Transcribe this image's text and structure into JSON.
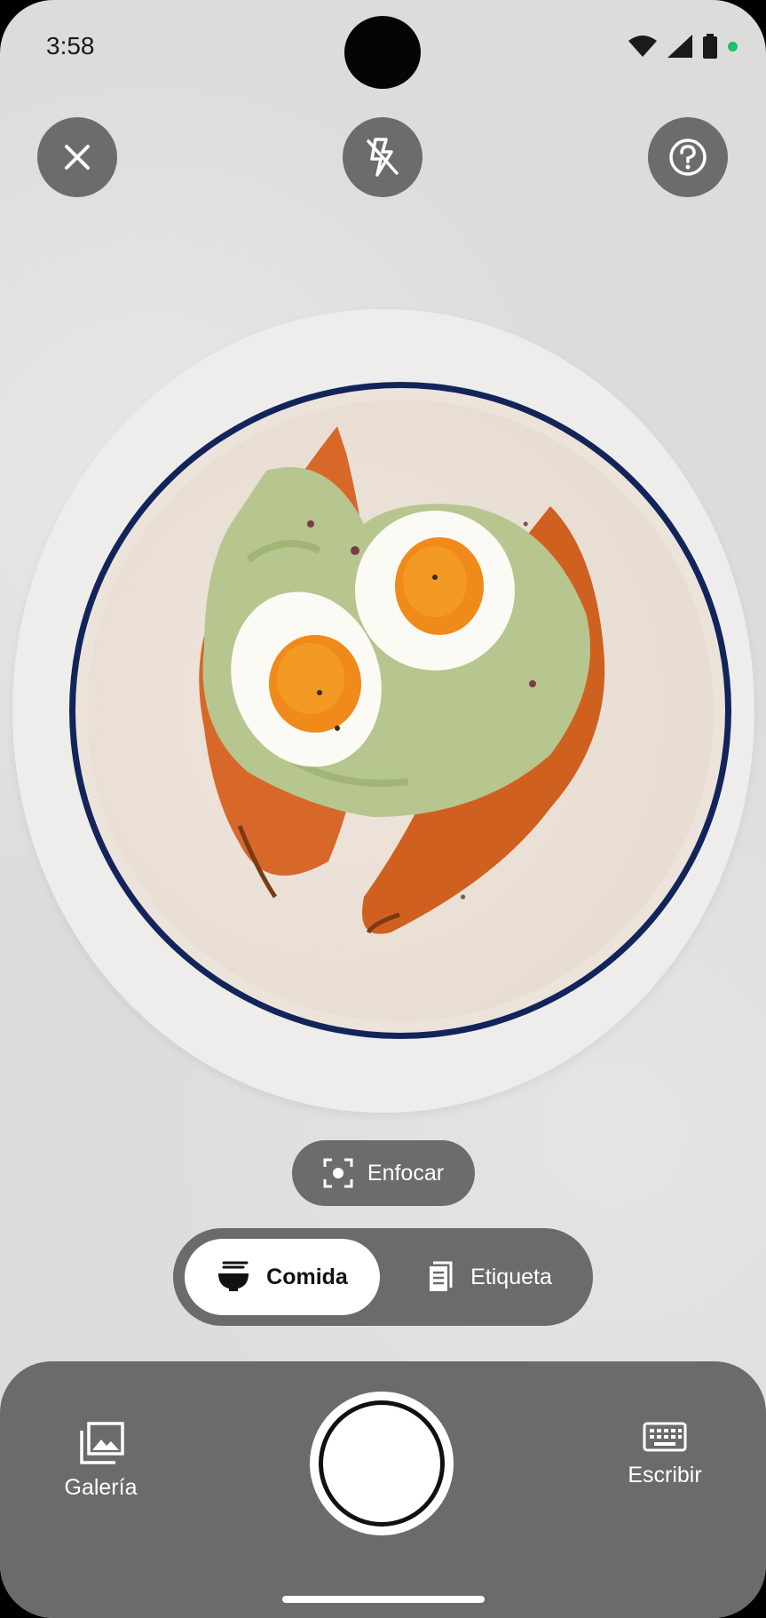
{
  "status_bar": {
    "time": "3:58"
  },
  "top_controls": {
    "close_icon": "close-icon",
    "flash_icon": "flash-off-icon",
    "help_icon": "help-icon"
  },
  "focus": {
    "label": "Enfocar",
    "icon": "focus-icon"
  },
  "modes": {
    "food": {
      "label": "Comida",
      "icon": "food-bowl-icon",
      "selected": true
    },
    "label": {
      "label": "Etiqueta",
      "icon": "nutrition-label-icon",
      "selected": false
    }
  },
  "bottom_bar": {
    "gallery_label": "Galería",
    "type_label": "Escribir"
  },
  "colors": {
    "accent_green": "#19c26b",
    "button_gray": "#6b6b6b",
    "plate_rim": "#13245a"
  }
}
